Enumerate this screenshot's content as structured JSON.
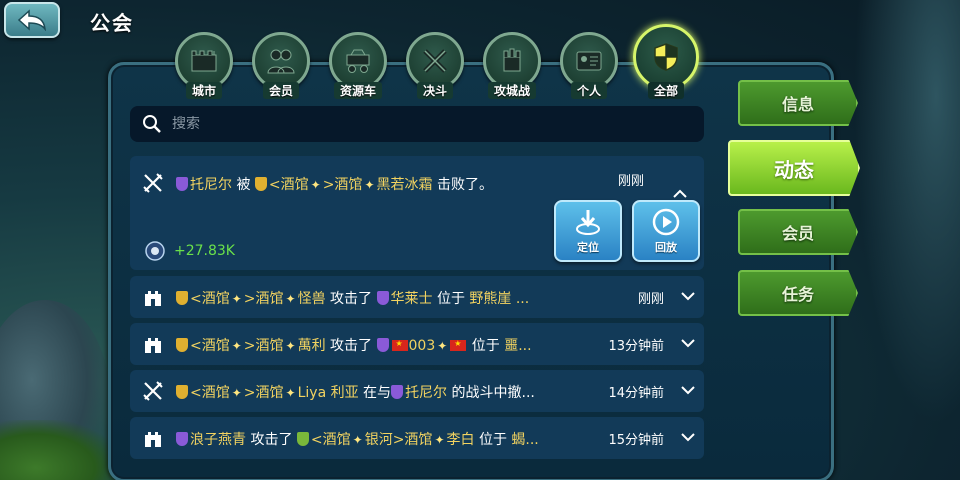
{
  "header": {
    "title": "公会"
  },
  "tabs": [
    {
      "label": "城市",
      "icon": "city-wall-icon"
    },
    {
      "label": "会员",
      "icon": "members-icon"
    },
    {
      "label": "资源车",
      "icon": "resource-cart-icon"
    },
    {
      "label": "决斗",
      "icon": "crossed-swords-icon"
    },
    {
      "label": "攻城战",
      "icon": "siege-icon"
    },
    {
      "label": "个人",
      "icon": "personal-card-icon"
    },
    {
      "label": "全部",
      "icon": "shield-all-icon",
      "active": true
    }
  ],
  "search": {
    "placeholder": "搜索"
  },
  "feed": [
    {
      "type": "duel",
      "parts": [
        "托尼尔",
        " 被 ",
        "<酒馆",
        ">酒馆",
        "黑若冰霜",
        " 击败了。"
      ],
      "time": "刚刚",
      "gain": "+27.83K",
      "actions": {
        "locate": "定位",
        "replay": "回放"
      }
    },
    {
      "type": "siege",
      "parts": [
        "<酒馆",
        ">酒馆",
        "怪兽",
        " 攻击了 ",
        "华莱士",
        " 位于 ",
        "野熊崖 ..."
      ],
      "time": "刚刚"
    },
    {
      "type": "siege",
      "parts": [
        "<酒馆",
        ">酒馆",
        "萬利",
        " 攻击了 ",
        "003",
        " 位于 ",
        "噩..."
      ],
      "time": "13分钟前"
    },
    {
      "type": "duel",
      "parts": [
        "<酒馆",
        ">酒馆",
        "Liya 利亚",
        " 在与",
        "托尼尔",
        " 的战斗中撤..."
      ],
      "time": "14分钟前"
    },
    {
      "type": "siege",
      "parts": [
        "浪子燕青",
        " 攻击了 ",
        "<酒馆",
        "银河>酒馆",
        "李白",
        " 位于 ",
        "蝎..."
      ],
      "time": "15分钟前"
    }
  ],
  "side_menu": [
    {
      "label": "信息"
    },
    {
      "label": "动态",
      "active": true
    },
    {
      "label": "会员"
    },
    {
      "label": "任务"
    }
  ],
  "colors": {
    "accent_green": "#b8f04a",
    "name_yellow": "#f2d360",
    "gain_green": "#6ae04a",
    "card_bg": "#123a58"
  }
}
